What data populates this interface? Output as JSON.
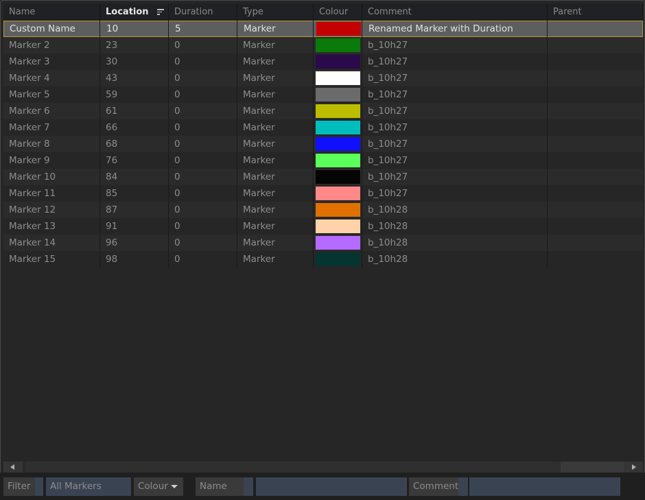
{
  "columns": [
    {
      "label": "Name"
    },
    {
      "label": "Location",
      "sorted": true
    },
    {
      "label": "Duration"
    },
    {
      "label": "Type"
    },
    {
      "label": "Colour"
    },
    {
      "label": "Comment"
    },
    {
      "label": "Parent"
    }
  ],
  "rows": [
    {
      "name": "Custom Name",
      "location": "10",
      "duration": "5",
      "type": "Marker",
      "colour": "#c40000",
      "comment": "Renamed Marker with Duration",
      "parent": "",
      "selected": true
    },
    {
      "name": "Marker 2",
      "location": "23",
      "duration": "0",
      "type": "Marker",
      "colour": "#0a7a0a",
      "comment": "b_10h27",
      "parent": ""
    },
    {
      "name": "Marker 3",
      "location": "30",
      "duration": "0",
      "type": "Marker",
      "colour": "#2a0a4a",
      "comment": "b_10h27",
      "parent": ""
    },
    {
      "name": "Marker 4",
      "location": "43",
      "duration": "0",
      "type": "Marker",
      "colour": "#ffffff",
      "comment": "b_10h27",
      "parent": ""
    },
    {
      "name": "Marker 5",
      "location": "59",
      "duration": "0",
      "type": "Marker",
      "colour": "#6b6b6b",
      "comment": "b_10h27",
      "parent": ""
    },
    {
      "name": "Marker 6",
      "location": "61",
      "duration": "0",
      "type": "Marker",
      "colour": "#bdbd00",
      "comment": "b_10h27",
      "parent": ""
    },
    {
      "name": "Marker 7",
      "location": "66",
      "duration": "0",
      "type": "Marker",
      "colour": "#00bdbd",
      "comment": "b_10h27",
      "parent": ""
    },
    {
      "name": "Marker 8",
      "location": "68",
      "duration": "0",
      "type": "Marker",
      "colour": "#1010ff",
      "comment": "b_10h27",
      "parent": ""
    },
    {
      "name": "Marker 9",
      "location": "76",
      "duration": "0",
      "type": "Marker",
      "colour": "#5aff5a",
      "comment": "b_10h27",
      "parent": ""
    },
    {
      "name": "Marker 10",
      "location": "84",
      "duration": "0",
      "type": "Marker",
      "colour": "#050505",
      "comment": "b_10h27",
      "parent": ""
    },
    {
      "name": "Marker 11",
      "location": "85",
      "duration": "0",
      "type": "Marker",
      "colour": "#ff8888",
      "comment": "b_10h27",
      "parent": ""
    },
    {
      "name": "Marker 12",
      "location": "87",
      "duration": "0",
      "type": "Marker",
      "colour": "#e07000",
      "comment": "b_10h28",
      "parent": ""
    },
    {
      "name": "Marker 13",
      "location": "91",
      "duration": "0",
      "type": "Marker",
      "colour": "#ffd2a8",
      "comment": "b_10h28",
      "parent": ""
    },
    {
      "name": "Marker 14",
      "location": "96",
      "duration": "0",
      "type": "Marker",
      "colour": "#b56bff",
      "comment": "b_10h28",
      "parent": ""
    },
    {
      "name": "Marker 15",
      "location": "98",
      "duration": "0",
      "type": "Marker",
      "colour": "#053530",
      "comment": "b_10h28",
      "parent": ""
    }
  ],
  "filter_bar": {
    "filter_label": "Filter",
    "marker_set": "All Markers",
    "colour_dropdown": "Colour",
    "name_label": "Name",
    "name_value": "",
    "comment_label": "Comment",
    "comment_value": ""
  }
}
